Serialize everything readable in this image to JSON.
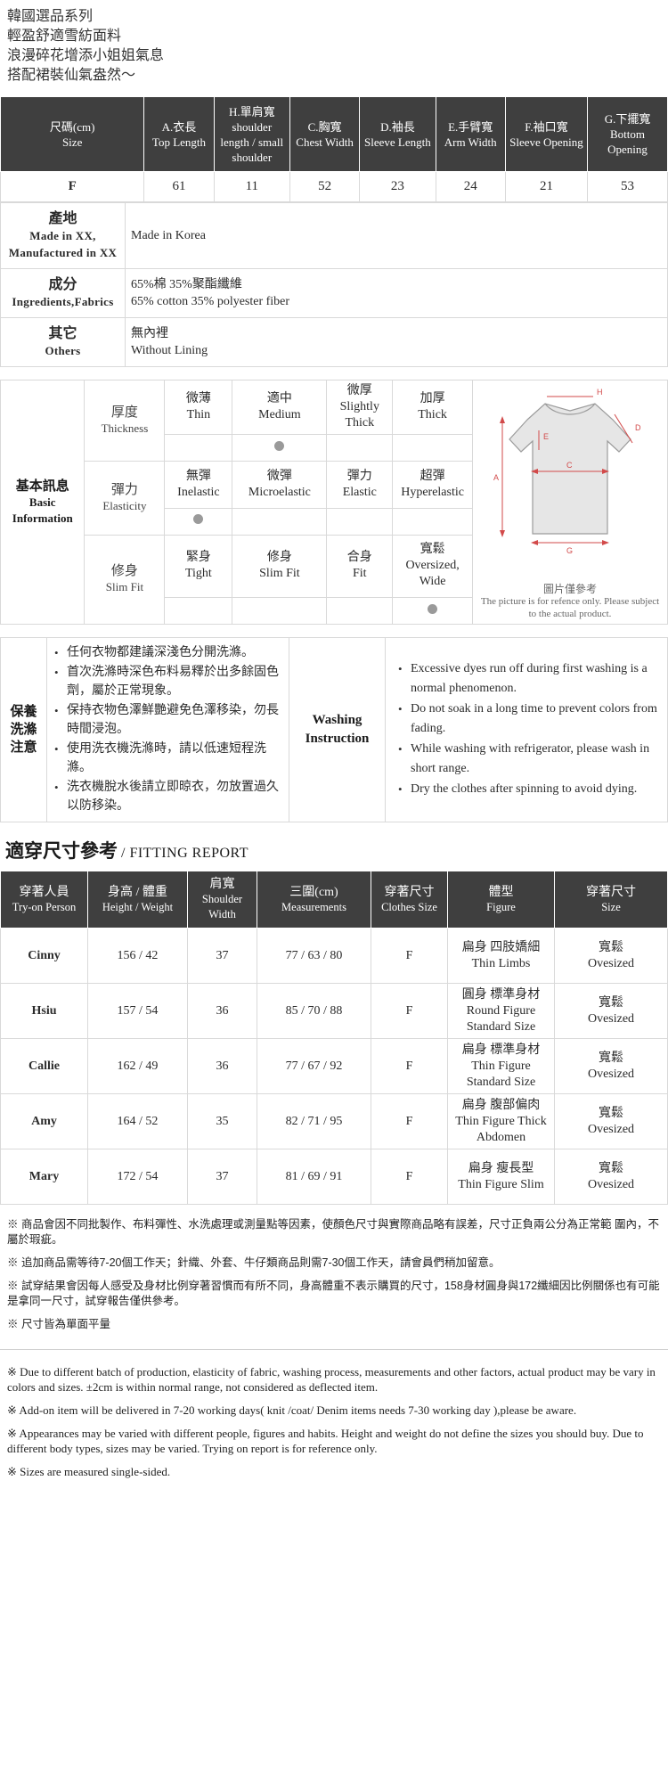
{
  "intro": {
    "lines": [
      "韓國選品系列",
      "輕盈舒適雪紡面料",
      "浪漫碎花增添小姐姐氣息",
      "搭配裙裝仙氣盎然～"
    ]
  },
  "size_table": {
    "headers": [
      {
        "cn": "尺碼(cm)",
        "en": "Size"
      },
      {
        "cn": "A.衣長",
        "en": "Top Length"
      },
      {
        "cn": "H.單肩寬",
        "en": "shoulder length / small shoulder"
      },
      {
        "cn": "C.胸寬",
        "en": "Chest Width"
      },
      {
        "cn": "D.袖長",
        "en": "Sleeve Length"
      },
      {
        "cn": "E.手臂寬",
        "en": "Arm Width"
      },
      {
        "cn": "F.袖口寬",
        "en": "Sleeve Opening"
      },
      {
        "cn": "G.下擺寬",
        "en": "Bottom Opening"
      }
    ],
    "rows": [
      [
        "F",
        "61",
        "11",
        "52",
        "23",
        "24",
        "21",
        "53"
      ]
    ]
  },
  "info_rows": [
    {
      "label_cn": "產地",
      "label_en": "Made in XX, Manufactured in XX",
      "value_cn": "Made in Korea",
      "value_en": ""
    },
    {
      "label_cn": "成分",
      "label_en": "Ingredients,Fabrics",
      "value_cn": "65%棉 35%聚酯纖維",
      "value_en": "65% cotton 35% polyester fiber"
    },
    {
      "label_cn": "其它",
      "label_en": "Others",
      "value_cn": "無內裡",
      "value_en": "Without Lining"
    }
  ],
  "basic_info": {
    "label_cn": "基本訊息",
    "label_en": "Basic Information",
    "groups": [
      {
        "name_cn": "厚度",
        "name_en": "Thickness",
        "options": [
          {
            "cn": "微薄",
            "en": "Thin"
          },
          {
            "cn": "適中",
            "en": "Medium"
          },
          {
            "cn": "微厚",
            "en": "Slightly Thick"
          },
          {
            "cn": "加厚",
            "en": "Thick"
          }
        ],
        "selected": 1
      },
      {
        "name_cn": "彈力",
        "name_en": "Elasticity",
        "options": [
          {
            "cn": "無彈",
            "en": "Inelastic"
          },
          {
            "cn": "微彈",
            "en": "Microelastic"
          },
          {
            "cn": "彈力",
            "en": "Elastic"
          },
          {
            "cn": "超彈",
            "en": "Hyperelastic"
          }
        ],
        "selected": 0
      },
      {
        "name_cn": "修身",
        "name_en": "Slim Fit",
        "options": [
          {
            "cn": "緊身",
            "en": "Tight"
          },
          {
            "cn": "修身",
            "en": "Slim Fit"
          },
          {
            "cn": "合身",
            "en": "Fit"
          },
          {
            "cn": "寬鬆",
            "en": "Oversized, Wide"
          }
        ],
        "selected": 3
      }
    ],
    "diagram_caption_cn": "圖片僅參考",
    "diagram_caption_en": "The picture is for refence only. Please subject to the actual product.",
    "diagram_labels": [
      "A",
      "C",
      "D",
      "E",
      "G",
      "H"
    ]
  },
  "washing": {
    "label_cn": [
      "保養",
      "洗滌",
      "注意"
    ],
    "mid_label": [
      "Washing",
      "Instruction"
    ],
    "items_cn": [
      "任何衣物都建議深淺色分開洗滌。",
      "首次洗滌時深色布料易釋於出多餘固色劑，屬於正常現象。",
      "保持衣物色澤鮮艷避免色澤移染，勿長時間浸泡。",
      "使用洗衣機洗滌時，請以低速短程洗滌。",
      "洗衣機脫水後請立即晾衣，勿放置過久以防移染。"
    ],
    "items_en": [
      "Excessive dyes run off during first washing is a normal phenomenon.",
      "Do not soak in a long time to prevent colors from fading.",
      "While washing with refrigerator, please wash in short range.",
      "Dry the clothes after spinning to avoid dying."
    ]
  },
  "fitting": {
    "title_cn": "適穿尺寸參考",
    "title_en": "/ FITTING REPORT",
    "headers": [
      {
        "cn": "穿著人員",
        "en": "Try-on Person"
      },
      {
        "cn": "身高 / 體重",
        "en": "Height / Weight"
      },
      {
        "cn": "肩寬",
        "en": "Shoulder Width"
      },
      {
        "cn": "三圍(cm)",
        "en": "Measurements"
      },
      {
        "cn": "穿著尺寸",
        "en": "Clothes Size"
      },
      {
        "cn": "體型",
        "en": "Figure"
      },
      {
        "cn": "穿著尺寸",
        "en": "Size"
      }
    ],
    "rows": [
      {
        "person": "Cinny",
        "hw": "156 / 42",
        "shoulder": "37",
        "measure": "77 / 63 / 80",
        "clothes_size": "F",
        "figure_cn": "扁身 四肢嬌細",
        "figure_en": "Thin Limbs",
        "size_cn": "寬鬆",
        "size_en": "Ovesized"
      },
      {
        "person": "Hsiu",
        "hw": "157 / 54",
        "shoulder": "36",
        "measure": "85 / 70 / 88",
        "clothes_size": "F",
        "figure_cn": "圓身 標準身材",
        "figure_en": "Round Figure Standard Size",
        "size_cn": "寬鬆",
        "size_en": "Ovesized"
      },
      {
        "person": "Callie",
        "hw": "162 / 49",
        "shoulder": "36",
        "measure": "77 / 67 / 92",
        "clothes_size": "F",
        "figure_cn": "扁身 標準身材",
        "figure_en": "Thin Figure Standard Size",
        "size_cn": "寬鬆",
        "size_en": "Ovesized"
      },
      {
        "person": "Amy",
        "hw": "164 / 52",
        "shoulder": "35",
        "measure": "82 / 71 / 95",
        "clothes_size": "F",
        "figure_cn": "扁身 腹部偏肉",
        "figure_en": "Thin Figure Thick Abdomen",
        "size_cn": "寬鬆",
        "size_en": "Ovesized"
      },
      {
        "person": "Mary",
        "hw": "172 / 54",
        "shoulder": "37",
        "measure": "81 / 69 / 91",
        "clothes_size": "F",
        "figure_cn": "扁身 瘦長型",
        "figure_en": "Thin Figure Slim",
        "size_cn": "寬鬆",
        "size_en": "Ovesized"
      }
    ]
  },
  "notes": {
    "cn": [
      "※ 商品會因不同批製作、布料彈性、水洗處理或測量點等因素，使顏色尺寸與實際商品略有誤差，尺寸正負兩公分為正常範 圍內，不屬於瑕疵。",
      "※ 追加商品需等待7-20個工作天；針織、外套、牛仔類商品則需7-30個工作天，請會員們稍加留意。",
      "※ 試穿結果會因每人感受及身材比例穿著習慣而有所不同，身高體重不表示購買的尺寸，158身材圓身與172纖細因比例關係也有可能是拿同一尺寸，試穿報告僅供參考。",
      "※ 尺寸皆為單面平量"
    ],
    "en": [
      "※ Due to different batch of production, elasticity of fabric, washing process, measurements and other factors, actual product may be vary in colors and sizes. ±2cm is within normal range, not considered as deflected item.",
      "※ Add-on item will be delivered in 7-20 working days( knit /coat/ Denim items needs 7-30 working day ),please be aware.",
      "※ Appearances may be varied with different people, figures and habits. Height and weight do not define the sizes you should buy. Due to different body types, sizes may be varied. Trying on report is for reference only.",
      "※ Sizes are measured single-sided."
    ]
  },
  "colors": {
    "header_bg": "#3f3f3f",
    "dot": "#9a9a9a",
    "diagram_line": "#d24a4a",
    "shirt_fill": "#e6e6e6"
  }
}
